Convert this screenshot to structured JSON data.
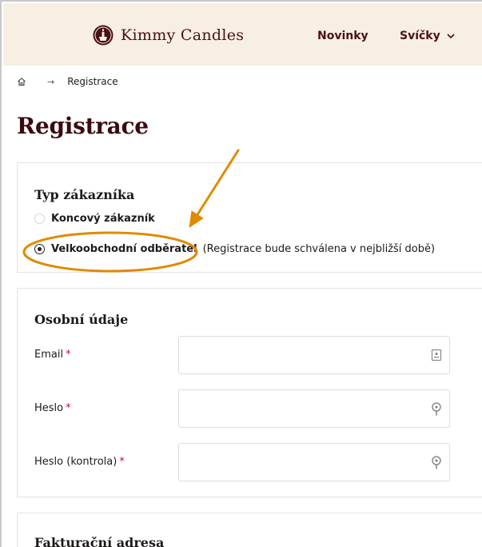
{
  "header": {
    "brand": "Kimmy Candles",
    "nav": [
      {
        "label": "Novinky"
      },
      {
        "label": "Svíčky"
      }
    ]
  },
  "breadcrumb": {
    "current": "Registrace"
  },
  "page_title": "Registrace",
  "customer_type": {
    "title": "Typ zákazníka",
    "options": [
      {
        "label": "Koncový zákazník",
        "checked": false
      },
      {
        "label": "Velkoobchodní odběratel",
        "checked": true,
        "note": "(Registrace bude schválena v nejbližší době)"
      }
    ]
  },
  "personal": {
    "title": "Osobní údaje",
    "fields": [
      {
        "label": "Email",
        "value": "",
        "required": "*"
      },
      {
        "label": "Heslo",
        "value": "",
        "required": "*"
      },
      {
        "label": "Heslo (kontrola)",
        "value": "",
        "required": "*"
      }
    ]
  },
  "billing": {
    "title": "Fakturační adresa"
  },
  "colors": {
    "header_bg": "#f7efe3",
    "brand": "#4a1016",
    "title": "#3a0b10",
    "required": "#c8102e",
    "annotation": "#e08a00"
  }
}
